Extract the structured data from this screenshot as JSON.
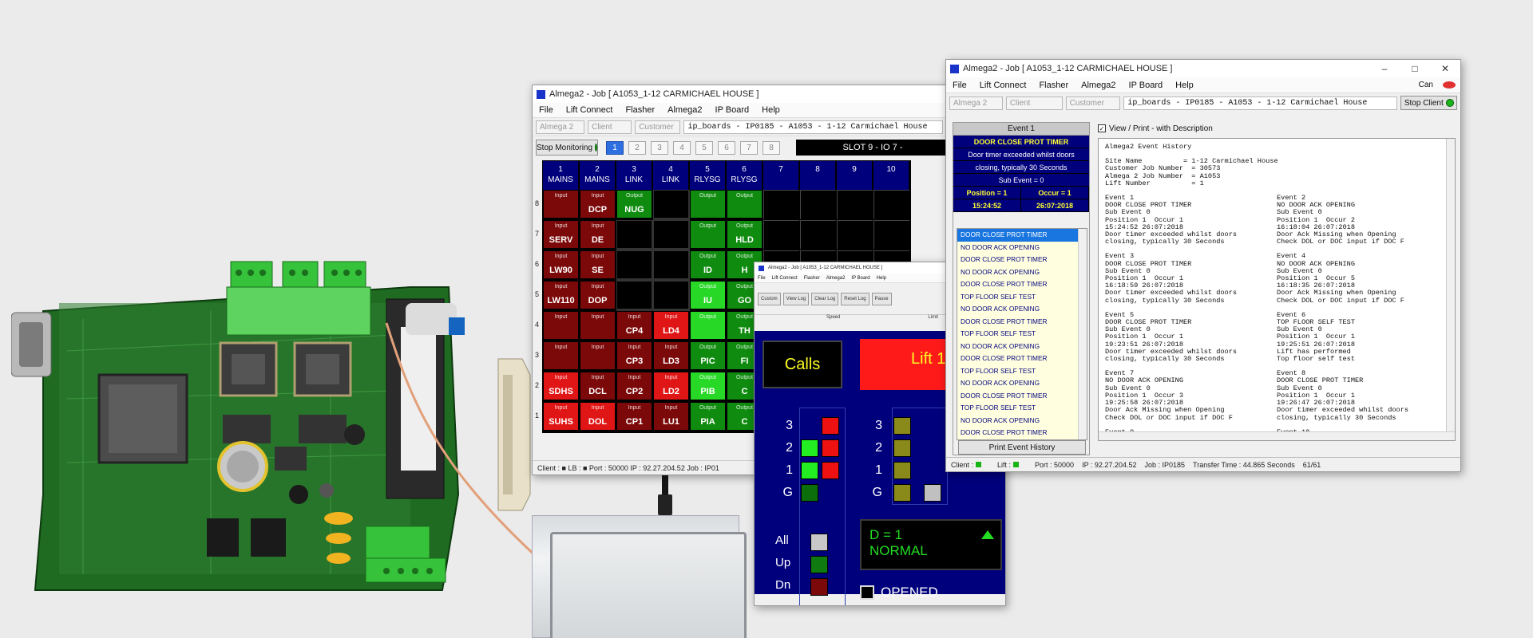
{
  "monitor_window": {
    "title": "Almega2 - Job [ A1053_1-12 CARMICHAEL HOUSE ]",
    "menu": [
      "File",
      "Lift Connect",
      "Flasher",
      "Almega2",
      "IP Board",
      "Help"
    ],
    "combos": [
      "Almega 2",
      "Client",
      "Customer"
    ],
    "active_combo": "ip_boards - IP0185 - A1053 - 1-12 Carmichael House",
    "stop_button": "Stop Monitoring",
    "slots": [
      "1",
      "2",
      "3",
      "4",
      "5",
      "6",
      "7",
      "8"
    ],
    "slot_info": "SLOT 9 - IO 7 -",
    "columns": [
      {
        "num": "1",
        "name": "MAINS"
      },
      {
        "num": "2",
        "name": "MAINS"
      },
      {
        "num": "3",
        "name": "LINK"
      },
      {
        "num": "4",
        "name": "LINK"
      },
      {
        "num": "5",
        "name": "RLYSG"
      },
      {
        "num": "6",
        "name": "RLYSG"
      },
      {
        "num": "7",
        "name": ""
      },
      {
        "num": "8",
        "name": ""
      },
      {
        "num": "9",
        "name": ""
      },
      {
        "num": "10",
        "name": ""
      }
    ],
    "rows": [
      {
        "label": "8",
        "cells": [
          [
            "Input",
            "",
            "in"
          ],
          [
            "Input",
            "DCP",
            "in"
          ],
          [
            "Output",
            "NUG",
            "out"
          ],
          [
            "",
            "",
            "off"
          ],
          [
            "Output",
            "",
            "out"
          ],
          [
            "Output",
            "",
            "out"
          ],
          [
            "",
            "",
            "none"
          ],
          [
            "",
            "",
            "none"
          ],
          [
            "",
            "",
            "none"
          ],
          [
            "",
            "",
            "none"
          ]
        ]
      },
      {
        "label": "7",
        "cells": [
          [
            "Input",
            "SERV",
            "in"
          ],
          [
            "Input",
            "DE",
            "in"
          ],
          [
            "",
            "",
            "off"
          ],
          [
            "",
            "",
            "off"
          ],
          [
            "Output",
            "",
            "out"
          ],
          [
            "Output",
            "HLD",
            "out"
          ],
          [
            "",
            "",
            "none"
          ],
          [
            "",
            "",
            "none"
          ],
          [
            "",
            "",
            "none"
          ],
          [
            "",
            "",
            "none"
          ]
        ]
      },
      {
        "label": "6",
        "cells": [
          [
            "Input",
            "LW90",
            "in"
          ],
          [
            "Input",
            "SE",
            "in"
          ],
          [
            "",
            "",
            "off"
          ],
          [
            "",
            "",
            "off"
          ],
          [
            "Output",
            "ID",
            "out"
          ],
          [
            "Output",
            "H",
            "out"
          ],
          [
            "",
            "",
            "none"
          ],
          [
            "",
            "",
            "none"
          ],
          [
            "",
            "",
            "none"
          ],
          [
            "",
            "",
            "none"
          ]
        ]
      },
      {
        "label": "5",
        "cells": [
          [
            "Input",
            "LW110",
            "in"
          ],
          [
            "Input",
            "DOP",
            "in"
          ],
          [
            "",
            "",
            "off"
          ],
          [
            "",
            "",
            "off"
          ],
          [
            "Output",
            "IU",
            "outb"
          ],
          [
            "Output",
            "GO",
            "out"
          ],
          [
            "",
            "",
            "none"
          ],
          [
            "",
            "",
            "none"
          ],
          [
            "",
            "",
            "none"
          ],
          [
            "",
            "",
            "none"
          ]
        ]
      },
      {
        "label": "4",
        "cells": [
          [
            "Input",
            "",
            "in"
          ],
          [
            "Input",
            "",
            "in"
          ],
          [
            "Input",
            "CP4",
            "in"
          ],
          [
            "Input",
            "LD4",
            "inb"
          ],
          [
            "Output",
            "",
            "outb"
          ],
          [
            "Output",
            "TH",
            "out"
          ],
          [
            "",
            "",
            "none"
          ],
          [
            "",
            "",
            "none"
          ],
          [
            "",
            "",
            "none"
          ],
          [
            "",
            "",
            "none"
          ]
        ]
      },
      {
        "label": "3",
        "cells": [
          [
            "Input",
            "",
            "in"
          ],
          [
            "Input",
            "",
            "in"
          ],
          [
            "Input",
            "CP3",
            "in"
          ],
          [
            "Input",
            "LD3",
            "in"
          ],
          [
            "Output",
            "PIC",
            "out"
          ],
          [
            "Output",
            "FI",
            "out"
          ],
          [
            "",
            "",
            "none"
          ],
          [
            "",
            "",
            "none"
          ],
          [
            "",
            "",
            "none"
          ],
          [
            "",
            "",
            "none"
          ]
        ]
      },
      {
        "label": "2",
        "cells": [
          [
            "Input",
            "SDHS",
            "inb"
          ],
          [
            "Input",
            "DCL",
            "in"
          ],
          [
            "Input",
            "CP2",
            "in"
          ],
          [
            "Input",
            "LD2",
            "inb"
          ],
          [
            "Output",
            "PIB",
            "outb"
          ],
          [
            "Output",
            "C",
            "out"
          ],
          [
            "",
            "",
            "none"
          ],
          [
            "",
            "",
            "none"
          ],
          [
            "",
            "",
            "none"
          ],
          [
            "",
            "",
            "none"
          ]
        ]
      },
      {
        "label": "1",
        "cells": [
          [
            "Input",
            "SUHS",
            "inb"
          ],
          [
            "Input",
            "DOL",
            "inb"
          ],
          [
            "Input",
            "CP1",
            "in"
          ],
          [
            "Input",
            "LU1",
            "in"
          ],
          [
            "Output",
            "PIA",
            "out"
          ],
          [
            "Output",
            "C",
            "out"
          ],
          [
            "",
            "",
            "none"
          ],
          [
            "",
            "",
            "none"
          ],
          [
            "",
            "",
            "none"
          ],
          [
            "",
            "",
            "none"
          ]
        ]
      }
    ],
    "status": "Client : ■   LB : ■   Port : 50000   IP : 92.27.204.52        Job : IP01"
  },
  "panel_window": {
    "title": "Almega2 - Job [ A1053_1-12 CARMICHAEL HOUSE ]",
    "menu": [
      "File",
      "Lift Connect",
      "Flasher",
      "Almega2",
      "IP Board",
      "Help"
    ],
    "tools": [
      "Custom",
      "View Log",
      "Clear Log",
      "Reset Log",
      "Pause"
    ],
    "speed_label": "Speed",
    "limit_label": "Limit",
    "calls_label": "Calls",
    "lift_label": "Lift 1",
    "floors": [
      "3",
      "2",
      "1",
      "G"
    ],
    "calls_left": [
      "",
      "green",
      "green",
      "darkgreen"
    ],
    "calls_right": [
      "red",
      "red",
      "red",
      ""
    ],
    "lift_floors": [
      "olive",
      "olive",
      "olive",
      "olive"
    ],
    "ctrl_labels": [
      "All",
      "Up",
      "Dn"
    ],
    "ctrl_colors": [
      "#c8c8c8",
      "#0f7a0f",
      "#7c0909"
    ],
    "door_status": "D = 1",
    "mode": "NORMAL",
    "opened_label": "OPENED"
  },
  "history_window": {
    "title": "Almega2 - Job [ A1053_1-12 CARMICHAEL HOUSE ]",
    "menu": [
      "File",
      "Lift Connect",
      "Flasher",
      "Almega2",
      "IP Board",
      "Help"
    ],
    "corner_label": "Can",
    "combos": [
      "Almega 2",
      "Client",
      "Customer"
    ],
    "active_combo": "ip_boards - IP0185 - A1053 - 1-12 Carmichael House",
    "stop_button": "Stop Client",
    "event_header": "Event 1",
    "event_name": "DOOR CLOSE PROT TIMER",
    "event_desc1": "Door timer exceeded whilst doors",
    "event_desc2": "closing, typically 30 Seconds",
    "sub_event": "Sub Event = 0",
    "position_label": "Position = 1",
    "occur_label": "Occur = 1",
    "event_time": "15:24:52",
    "event_date": "26:07:2018",
    "event_list": [
      "DOOR CLOSE PROT TIMER",
      "NO DOOR ACK OPENING",
      "DOOR CLOSE PROT TIMER",
      "NO DOOR ACK OPENING",
      "DOOR CLOSE PROT TIMER",
      "TOP FLOOR SELF TEST",
      "NO DOOR ACK OPENING",
      "DOOR CLOSE PROT TIMER",
      "TOP FLOOR SELF TEST",
      "NO DOOR ACK OPENING",
      "DOOR CLOSE PROT TIMER",
      "TOP FLOOR SELF TEST",
      "NO DOOR ACK OPENING",
      "DOOR CLOSE PROT TIMER",
      "TOP FLOOR SELF TEST",
      "NO DOOR ACK OPENING",
      "DOOR CLOSE PROT TIMER"
    ],
    "print_button": "Print Event History",
    "view_checkbox": "View / Print - with Description",
    "history_title": "Almega2 Event History",
    "site_lines": [
      "Site Name          = 1-12 Carmichael House",
      "Customer Job Number  = 30573",
      "Almega 2 Job Number  = A1053",
      "Lift Number          = 1"
    ],
    "events_left": [
      [
        "Event 1",
        "DOOR CLOSE PROT TIMER",
        "Sub Event 0",
        "Position 1  Occur 1",
        "15:24:52 26:07:2018",
        "Door timer exceeded whilst doors",
        "closing, typically 30 Seconds"
      ],
      [
        "Event 3",
        "DOOR CLOSE PROT TIMER",
        "Sub Event 0",
        "Position 1  Occur 1",
        "16:18:59 26:07:2018",
        "Door timer exceeded whilst doors",
        "closing, typically 30 Seconds"
      ],
      [
        "Event 5",
        "DOOR CLOSE PROT TIMER",
        "Sub Event 0",
        "Position 1  Occur 1",
        "19:23:51 26:07:2018",
        "Door timer exceeded whilst doors",
        "closing, typically 30 Seconds"
      ],
      [
        "Event 7",
        "NO DOOR ACK OPENING",
        "Sub Event 0",
        "Position 1  Occur 3",
        "19:25:58 26:07:2018",
        "Door Ack Missing when Opening",
        "Check DOL or DOC input if DOC F"
      ],
      [
        "Event 9"
      ]
    ],
    "events_right": [
      [
        "Event 2",
        "NO DOOR ACK OPENING",
        "Sub Event 0",
        "Position 1  Occur 2",
        "16:18:04 26:07:2018",
        "Door Ack Missing when Opening",
        "Check DOL or DOC input if DOC F"
      ],
      [
        "Event 4",
        "NO DOOR ACK OPENING",
        "Sub Event 0",
        "Position 1  Occur 5",
        "16:18:35 26:07:2018",
        "Door Ack Missing when Opening",
        "Check DOL or DOC input if DOC F"
      ],
      [
        "Event 6",
        "TOP FLOOR SELF TEST",
        "Sub Event 0",
        "Position 1  Occur 1",
        "19:25:51 26:07:2018",
        "Lift has performed",
        "Top floor self test"
      ],
      [
        "Event 8",
        "DOOR CLOSE PROT TIMER",
        "Sub Event 0",
        "Position 1  Occur 1",
        "19:26:47 26:07:2018",
        "Door timer exceeded whilst doors",
        "closing, typically 30 Seconds"
      ],
      [
        "Event 10"
      ]
    ],
    "status_items": [
      "Client :",
      "Lift :",
      "Port : 50000",
      "IP : 92.27.204.52",
      "Job : IP0185",
      "Transfer Time : 44.865 Seconds",
      "61/61"
    ]
  },
  "colors": {
    "monitor_blue": "#00007c",
    "input_red": "#7c0909",
    "output_green": "#0f8c0f",
    "pcb_green": "#2e7d32"
  },
  "icons": [
    "app-icon",
    "status-led-icon",
    "pcb-board-photo",
    "antenna-photo",
    "enclosure-photo"
  ]
}
